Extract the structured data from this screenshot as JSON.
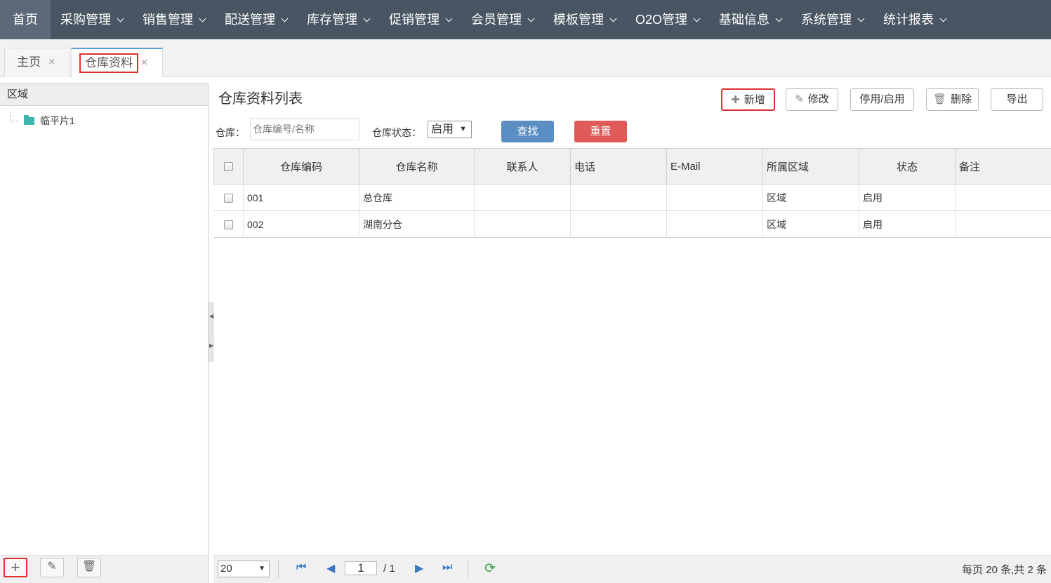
{
  "nav": {
    "items": [
      {
        "label": "首页",
        "dropdown": false
      },
      {
        "label": "采购管理",
        "dropdown": true
      },
      {
        "label": "销售管理",
        "dropdown": true
      },
      {
        "label": "配送管理",
        "dropdown": true
      },
      {
        "label": "库存管理",
        "dropdown": true
      },
      {
        "label": "促销管理",
        "dropdown": true
      },
      {
        "label": "会员管理",
        "dropdown": true
      },
      {
        "label": "模板管理",
        "dropdown": true
      },
      {
        "label": "O2O管理",
        "dropdown": true
      },
      {
        "label": "基础信息",
        "dropdown": true
      },
      {
        "label": "系统管理",
        "dropdown": true
      },
      {
        "label": "统计报表",
        "dropdown": true
      }
    ]
  },
  "tabs": [
    {
      "label": "主页",
      "close": "×"
    },
    {
      "label": "仓库资料",
      "close": "×"
    }
  ],
  "left": {
    "header": "区域",
    "tree": [
      {
        "label": "临平片1",
        "icon": "folder-icon"
      }
    ],
    "tools": {
      "add": "+",
      "edit": "✎",
      "delete": "🗑"
    }
  },
  "main": {
    "title": "仓库资料列表",
    "buttons": {
      "add": "新增",
      "edit": "修改",
      "toggle": "停用/启用",
      "delete": "删除",
      "export": "导出"
    },
    "filters": {
      "warehouse_label": "仓库：",
      "warehouse_placeholder": "仓库编号/名称",
      "status_label": "仓库状态：",
      "status_value": "启用",
      "search": "查找",
      "reset": "重置"
    },
    "columns": [
      "仓库编码",
      "仓库名称",
      "联系人",
      "电话",
      "E-Mail",
      "所属区域",
      "状态",
      "备注"
    ],
    "rows": [
      {
        "code": "001",
        "name": "总仓库",
        "contact": "",
        "phone": "",
        "email": "",
        "region": "区域",
        "status": "启用",
        "note": ""
      },
      {
        "code": "002",
        "name": "湖南分仓",
        "contact": "",
        "phone": "",
        "email": "",
        "region": "区域",
        "status": "启用",
        "note": ""
      }
    ],
    "pager": {
      "page_size": "20",
      "page": "1",
      "total_pages": "/ 1",
      "info": "每页 20 条,共 2 条"
    }
  },
  "colors": {
    "nav_bg": "#4a5563",
    "search_btn": "#5b8ec2",
    "reset_btn": "#e05a5a",
    "highlight": "#e03030"
  }
}
